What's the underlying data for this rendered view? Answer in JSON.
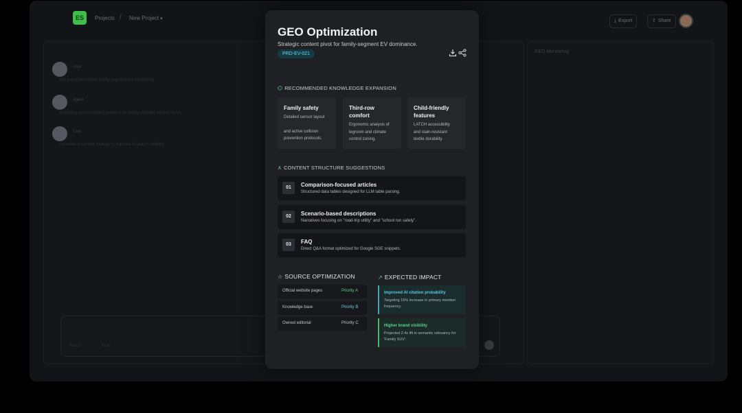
{
  "background": {
    "logo_text": "ES",
    "breadcrumb": {
      "projects": "Projects",
      "separator": "/",
      "current": "New Project"
    },
    "export_label": "Export",
    "share_label": "Share",
    "side_panel_title": "GEO Monitoring",
    "messages": [
      {
        "name": "User",
        "text": "Ask a question about family-segment EV positioning"
      },
      {
        "name": "Agent",
        "text": "Analyzing current citation patterns for family-oriented electric SUVs"
      },
      {
        "name": "User",
        "text": "Generate a content strategy to improve AI search visibility"
      }
    ],
    "composer": {
      "attach_label": "Attach",
      "tools_label": "Tools"
    }
  },
  "modal": {
    "title": "GEO Optimization",
    "subtitle": "Strategic content pivot for family-segment EV dominance.",
    "badge": "PRD-EV-021",
    "knowledge": {
      "heading": "RECOMMENDED KNOWLEDGE EXPANSION",
      "cards": [
        {
          "title": "Family safety",
          "desc": [
            "Detailed sensor layout",
            "and active collision",
            "prevention protocols."
          ]
        },
        {
          "title": "Third-row comfort",
          "desc": [
            "Ergonomic analysis of",
            "legroom and climate",
            "control zoning."
          ]
        },
        {
          "title": "Child-friendly features",
          "desc": [
            "LATCH accessibility",
            "and stain-resistant",
            "textile durability."
          ]
        }
      ]
    },
    "structure": {
      "heading": "CONTENT STRUCTURE SUGGESTIONS",
      "items": [
        {
          "num": "01",
          "title": "Comparison-focused articles",
          "desc": "Structured data tables designed for LLM table parsing."
        },
        {
          "num": "02",
          "title": "Scenario-based descriptions",
          "desc": "Narratives focusing on \"road-trip utility\" and \"school run safety\"."
        },
        {
          "num": "03",
          "title": "FAQ",
          "desc": "Direct Q&A format optimized for Google SGE snippets."
        }
      ]
    },
    "sources": {
      "heading": "SOURCE OPTIMIZATION",
      "rows": [
        {
          "name": "Official website pages",
          "priority": "Priority A"
        },
        {
          "name": "Knowledge base",
          "priority": "Priority B"
        },
        {
          "name": "Owned editorial",
          "priority": "Priority C"
        }
      ]
    },
    "impact": {
      "heading": "EXPECTED IMPACT",
      "items": [
        {
          "title": "Improved AI citation probability",
          "desc": "Targeting 15% increase in primary mention frequency."
        },
        {
          "title": "Higher brand visibility",
          "desc": "Projected 2.4x lift in semantic relevancy for 'Family SUV'."
        }
      ]
    }
  },
  "colors": {
    "accent_green": "#5bd38a",
    "accent_cyan": "#6ed3e0",
    "modal_bg": "#1f2024"
  }
}
